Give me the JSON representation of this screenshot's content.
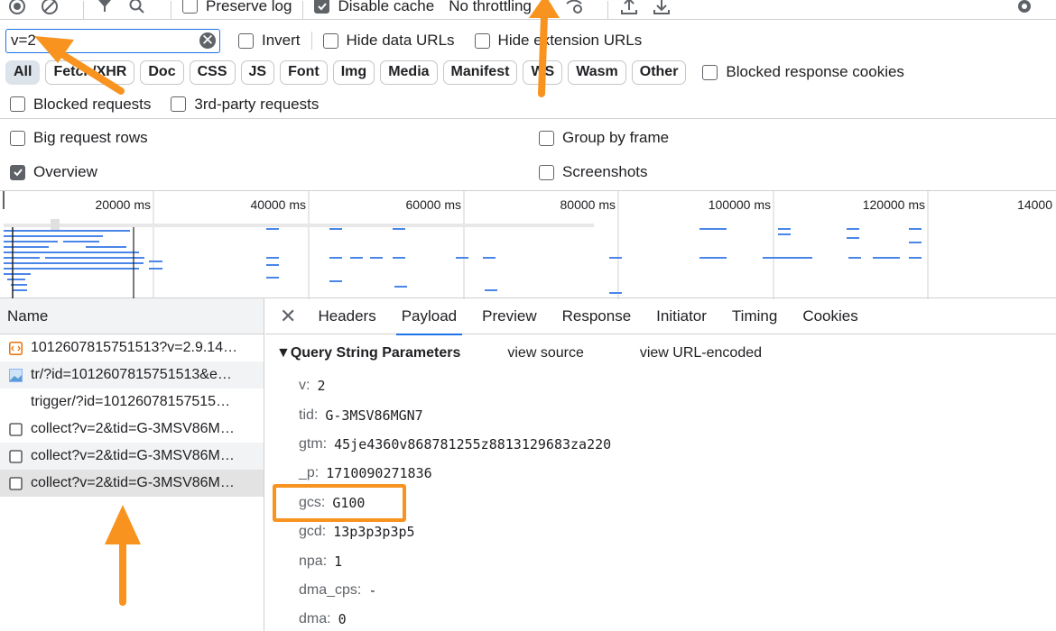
{
  "toolbar": {
    "preserve_log": "Preserve log",
    "disable_cache": "Disable cache",
    "throttling": "No throttling"
  },
  "filter": {
    "value": "v=2",
    "invert": "Invert",
    "hide_data_urls": "Hide data URLs",
    "hide_extension_urls": "Hide extension URLs"
  },
  "chips": [
    "All",
    "Fetch/XHR",
    "Doc",
    "CSS",
    "JS",
    "Font",
    "Img",
    "Media",
    "Manifest",
    "WS",
    "Wasm",
    "Other"
  ],
  "blocked_response_cookies": "Blocked response cookies",
  "options": {
    "blocked_requests": "Blocked requests",
    "third_party": "3rd-party requests",
    "big_rows": "Big request rows",
    "group_by_frame": "Group by frame",
    "overview": "Overview",
    "screenshots": "Screenshots"
  },
  "timeline": {
    "ticks": [
      "20000 ms",
      "40000 ms",
      "60000 ms",
      "80000 ms",
      "100000 ms",
      "120000 ms",
      "14000"
    ]
  },
  "requests": {
    "header": "Name",
    "items": [
      {
        "name": "1012607815751513?v=2.9.14…",
        "type": "script"
      },
      {
        "name": "tr/?id=1012607815751513&e…",
        "type": "image"
      },
      {
        "name": "trigger/?id=10126078157515…",
        "type": "none"
      },
      {
        "name": "collect?v=2&tid=G-3MSV86M…",
        "type": "doc"
      },
      {
        "name": "collect?v=2&tid=G-3MSV86M…",
        "type": "doc"
      },
      {
        "name": "collect?v=2&tid=G-3MSV86M…",
        "type": "doc"
      }
    ]
  },
  "detail": {
    "tabs": [
      "Headers",
      "Payload",
      "Preview",
      "Response",
      "Initiator",
      "Timing",
      "Cookies"
    ],
    "active_tab": "Payload",
    "section_title": "▼Query String Parameters",
    "view_source": "view source",
    "view_url_encoded": "view URL-encoded",
    "params": [
      {
        "key": "v:",
        "value": "2"
      },
      {
        "key": "tid:",
        "value": "G-3MSV86MGN7"
      },
      {
        "key": "gtm:",
        "value": "45je4360v868781255z8813129683za220"
      },
      {
        "key": "_p:",
        "value": "1710090271836"
      },
      {
        "key": "gcs:",
        "value": "G100"
      },
      {
        "key": "gcd:",
        "value": "13p3p3p3p5"
      },
      {
        "key": "npa:",
        "value": "1"
      },
      {
        "key": "dma_cps:",
        "value": "-"
      },
      {
        "key": "dma:",
        "value": "0"
      }
    ]
  },
  "colors": {
    "accent": "#1a73e8",
    "annotation": "#f7931e",
    "waterfall": "#4a86e8"
  }
}
